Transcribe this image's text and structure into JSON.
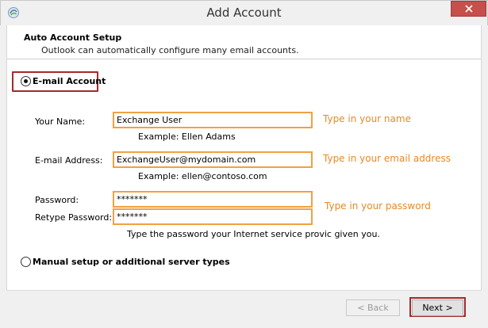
{
  "window": {
    "title": "Add Account"
  },
  "header": {
    "title": "Auto Account Setup",
    "subtitle": "Outlook can automatically configure many email accounts."
  },
  "options": {
    "email_account_label": "E-mail Account",
    "manual_setup_label": "Manual setup or additional server types"
  },
  "form": {
    "name_label": "Your Name:",
    "name_value": "Exchange User",
    "name_example": "Example: Ellen Adams",
    "name_hint": "Type in your name",
    "email_label": "E-mail Address:",
    "email_value": "ExchangeUser@mydomain.com",
    "email_example": "Example: ellen@contoso.com",
    "email_hint": "Type in your email address",
    "password_label": "Password:",
    "password_value": "*******",
    "retype_label": "Retype Password:",
    "retype_value": "*******",
    "password_hint": "Type in your password",
    "password_note": "Type the password your Internet service provic    given you."
  },
  "buttons": {
    "back_label": "< Back",
    "next_label": "Next >"
  },
  "colors": {
    "highlight": "#a32b2b",
    "input_border": "#f0a142",
    "hint_text": "#e68a25",
    "close_button": "#c7504c"
  }
}
